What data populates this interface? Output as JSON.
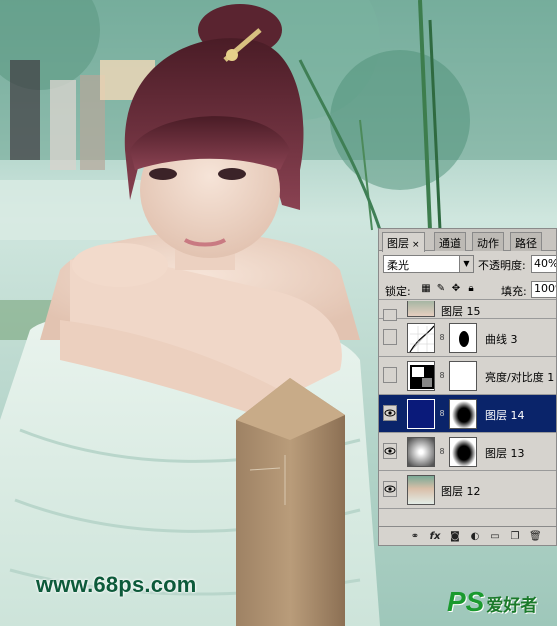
{
  "watermark": {
    "url": "www.68ps.com",
    "logo_ps": "PS",
    "logo_text": "爱好者"
  },
  "layers_panel": {
    "tabs": [
      {
        "label": "图层",
        "close": "×",
        "active": true
      },
      {
        "label": "通道",
        "active": false
      },
      {
        "label": "动作",
        "active": false
      },
      {
        "label": "路径",
        "active": false
      }
    ],
    "blend_mode": "柔光",
    "opacity_label": "不透明度:",
    "opacity_value": "40%",
    "lock_label": "锁定:",
    "fill_label": "填充:",
    "fill_value": "100%",
    "layers": [
      {
        "name": "图层 15",
        "visible": false,
        "selected": false,
        "thumb": "photo",
        "mask": false
      },
      {
        "name": "曲线 3",
        "visible": false,
        "selected": false,
        "thumb": "curves",
        "mask": "dark-blob"
      },
      {
        "name": "亮度/对比度 1",
        "visible": false,
        "selected": false,
        "thumb": "brightness",
        "mask": "white"
      },
      {
        "name": "图层 14",
        "visible": true,
        "selected": true,
        "thumb": "navy",
        "mask": "dark-oval"
      },
      {
        "name": "图层 13",
        "visible": true,
        "selected": false,
        "thumb": "gradient",
        "mask": "dark-oval"
      },
      {
        "name": "图层 12",
        "visible": true,
        "selected": false,
        "thumb": "photo",
        "mask": false
      }
    ],
    "footer_icons": [
      "link-icon",
      "fx-icon",
      "mask-icon",
      "adjustment-icon",
      "group-icon",
      "new-layer-icon",
      "trash-icon"
    ]
  },
  "colors": {
    "selected_row": "#0a246a",
    "panel_bg": "#d6d3ce",
    "watermark_green": "#0d5a3a"
  }
}
